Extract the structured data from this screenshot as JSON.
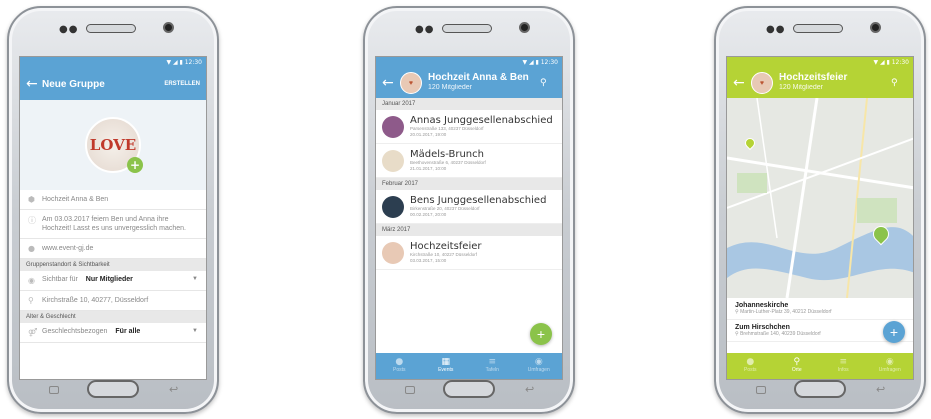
{
  "status": {
    "time": "12:30"
  },
  "screen1": {
    "title": "Neue Gruppe",
    "action": "ERSTELLEN",
    "avatar_text": "LOVE",
    "name": "Hochzeit Anna & Ben",
    "description": "Am 03.03.2017 feiern Ben und Anna ihre Hochzeit! Lasst es uns unvergesslich machen.",
    "website": "www.event-gj.de",
    "section_location": "Gruppenstandort & Sichtbarkeit",
    "visibility_label": "Sichtbar für",
    "visibility_value": "Nur Mitglieder",
    "address": "Kirchstraße 10, 40277, Düsseldorf",
    "section_age": "Alter & Geschlecht",
    "gender_label": "Geschlechtsbezogen",
    "gender_value": "Für alle"
  },
  "screen2": {
    "title": "Hochzeit Anna & Ben",
    "subtitle": "120 Mitglieder",
    "months": [
      {
        "label": "Januar 2017",
        "events": [
          {
            "name": "Annas Junggesellenabschied",
            "addr": "Parsenstraße 133, 40237 Düsseldorf",
            "date": "20.01.2017, 19:00",
            "color": "#8e5a8a"
          },
          {
            "name": "Mädels-Brunch",
            "addr": "Beethovenstraße 6, 40237 Düsseldorf",
            "date": "21.01.2017, 10:00",
            "color": "#e8dcc8"
          }
        ]
      },
      {
        "label": "Februar 2017",
        "events": [
          {
            "name": "Bens Junggesellenabschied",
            "addr": "Birkenstraße 20, 40237 Düsseldorf",
            "date": "00.02.2017, 20:00",
            "color": "#2c3e50"
          }
        ]
      },
      {
        "label": "März 2017",
        "events": [
          {
            "name": "Hochzeitsfeier",
            "addr": "Kirchstraße 10, 40227 Düsseldorf",
            "date": "03.03.2017, 15:00",
            "color": "#e8c9b5"
          }
        ]
      }
    ],
    "tabs": [
      {
        "label": "Posts",
        "icon": "●"
      },
      {
        "label": "Events",
        "icon": "▦"
      },
      {
        "label": "Tafeln",
        "icon": "≡"
      },
      {
        "label": "Umfragen",
        "icon": "◉"
      }
    ]
  },
  "screen3": {
    "title": "Hochzeitsfeier",
    "subtitle": "120 Mitglieder",
    "places": [
      {
        "name": "Johanneskirche",
        "addr": "Martin-Luther-Platz 39, 40212 Düsseldorf"
      },
      {
        "name": "Zum Hirschchen",
        "addr": "Brehmstraße 140, 40239 Düsseldorf"
      }
    ],
    "tabs": [
      {
        "label": "Posts",
        "icon": "●"
      },
      {
        "label": "Orte",
        "icon": "⚲"
      },
      {
        "label": "Infos",
        "icon": "≡"
      },
      {
        "label": "Umfragen",
        "icon": "◉"
      }
    ]
  },
  "colors": {
    "blue": "#5ba3d4",
    "green": "#8bc34a",
    "lime": "#b5d335"
  }
}
